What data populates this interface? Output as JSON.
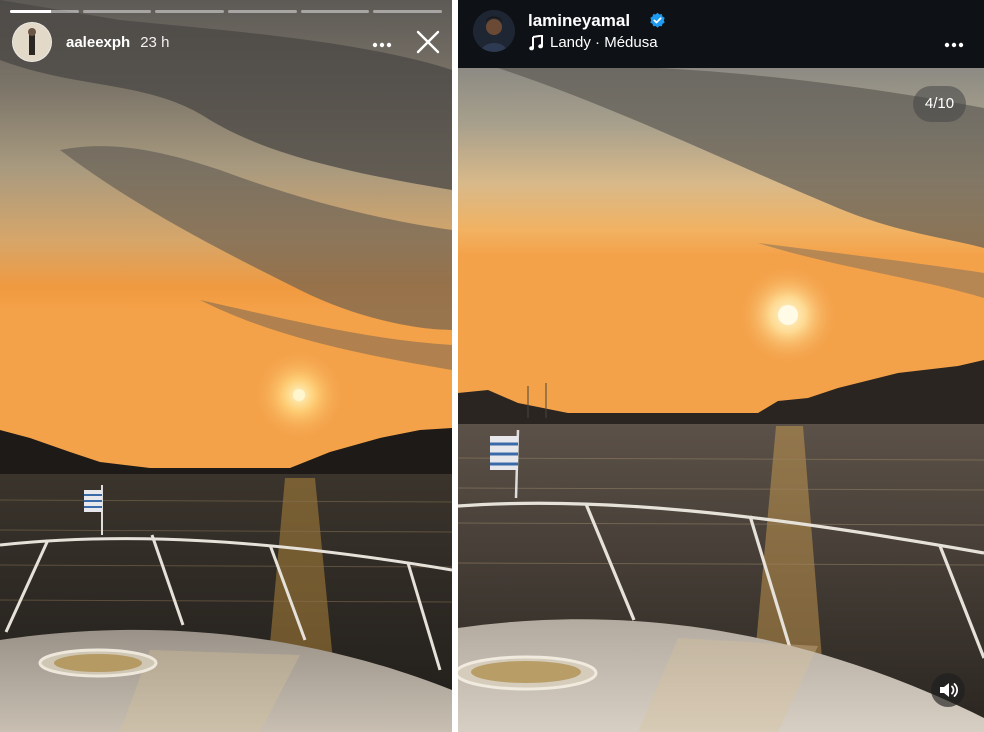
{
  "left_story": {
    "username": "aaleexph",
    "time_ago": "23 h",
    "progress": {
      "segments": 6,
      "active_index": 0,
      "active_fraction": 0.6
    },
    "icons": {
      "more": "more-horizontal-icon",
      "close": "close-icon"
    }
  },
  "right_post": {
    "username": "lamineyamal",
    "verified": true,
    "music": {
      "song": "Landy",
      "separator": " · ",
      "artist": "Médusa"
    },
    "counter": "4/10",
    "icons": {
      "more": "more-horizontal-icon",
      "sound": "sound-on-icon",
      "music": "music-note-icon",
      "verified": "verified-badge-icon"
    }
  },
  "colors": {
    "header_dark": "#0e1116",
    "verified_blue": "#1d9bf0",
    "sky_warm": "#f4a24a",
    "sun": "#fff2b0"
  }
}
